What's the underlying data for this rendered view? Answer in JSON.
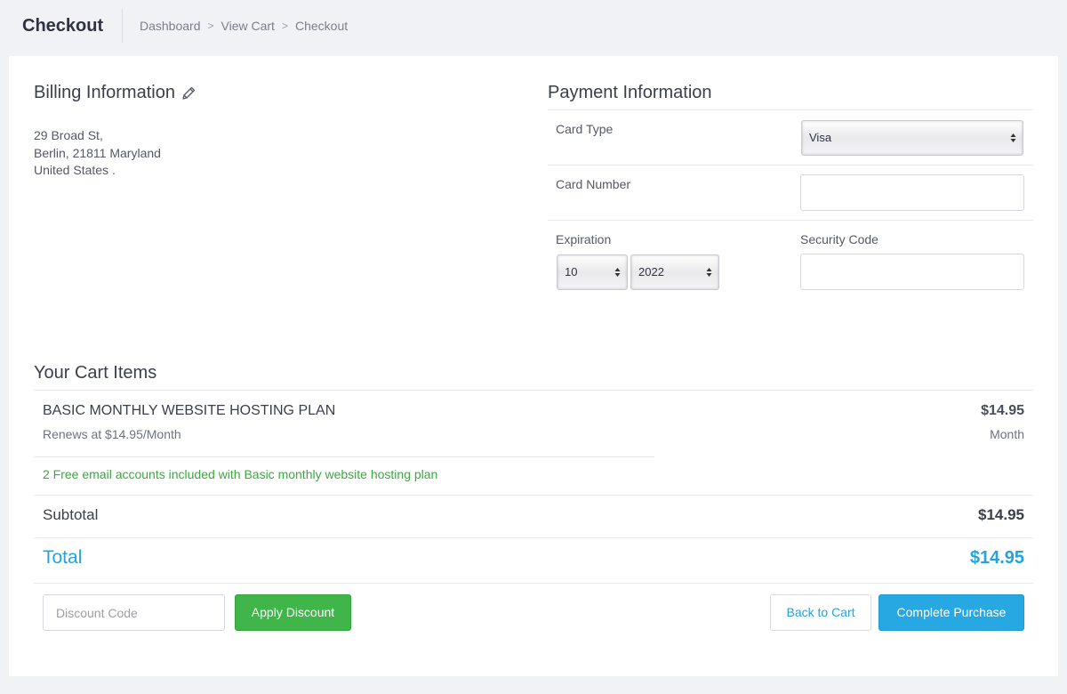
{
  "header": {
    "title": "Checkout",
    "breadcrumb": [
      "Dashboard",
      "View Cart",
      "Checkout"
    ],
    "separator": ">"
  },
  "billing": {
    "title": "Billing Information",
    "address_lines": [
      "29 Broad St,",
      "Berlin, 21811 Maryland",
      "United States ."
    ]
  },
  "payment": {
    "title": "Payment Information",
    "card_type_label": "Card Type",
    "card_type_value": "Visa",
    "card_number_label": "Card Number",
    "card_number_value": "",
    "expiration_label": "Expiration",
    "expiration_month": "10",
    "expiration_year": "2022",
    "security_code_label": "Security Code",
    "security_code_value": ""
  },
  "cart": {
    "title": "Your Cart Items",
    "items": [
      {
        "name": "BASIC MONTHLY WEBSITE HOSTING PLAN",
        "renew": "Renews at $14.95/Month",
        "price": "$14.95",
        "period": "Month",
        "promo": "2 Free email accounts included with Basic monthly website hosting plan"
      }
    ],
    "subtotal_label": "Subtotal",
    "subtotal_value": "$14.95",
    "total_label": "Total",
    "total_value": "$14.95"
  },
  "actions": {
    "discount_placeholder": "Discount Code",
    "apply_discount": "Apply Discount",
    "back_to_cart": "Back to Cart",
    "complete_purchase": "Complete Purchase"
  },
  "colors": {
    "accent_blue": "#28a8e3",
    "success_green": "#3fb54a",
    "promo_green": "#3aaa3f"
  }
}
